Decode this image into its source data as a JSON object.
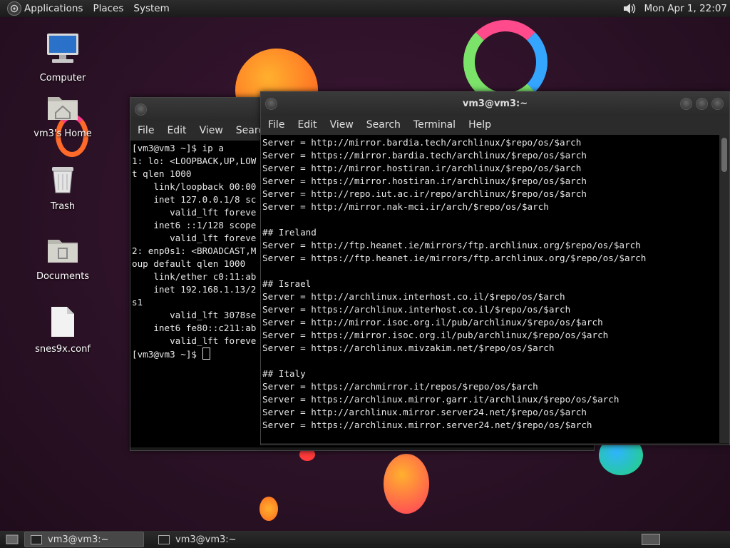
{
  "panel": {
    "menus": [
      "Applications",
      "Places",
      "System"
    ],
    "clock": "Mon Apr 1, 22:07"
  },
  "desktop_icons": [
    {
      "label": "Computer"
    },
    {
      "label": "vm3's Home"
    },
    {
      "label": "Trash"
    },
    {
      "label": "Documents"
    },
    {
      "label": "snes9x.conf"
    }
  ],
  "back_window": {
    "menus": [
      "File",
      "Edit",
      "View",
      "Search"
    ],
    "lines": [
      "[vm3@vm3 ~]$ ip a",
      "1: lo: <LOOPBACK,UP,LOW",
      "t qlen 1000",
      "    link/loopback 00:00",
      "    inet 127.0.0.1/8 sc",
      "       valid_lft foreve",
      "    inet6 ::1/128 scope",
      "       valid_lft foreve",
      "2: enp0s1: <BROADCAST,M",
      "oup default qlen 1000",
      "    link/ether c0:11:ab",
      "    inet 192.168.1.13/2",
      "s1",
      "       valid_lft 3078se",
      "    inet6 fe80::c211:ab",
      "       valid_lft foreve"
    ],
    "prompt": "[vm3@vm3 ~]$ "
  },
  "front_window": {
    "title": "vm3@vm3:~",
    "menus": [
      "File",
      "Edit",
      "View",
      "Search",
      "Terminal",
      "Help"
    ],
    "lines": [
      "Server = http://mirror.bardia.tech/archlinux/$repo/os/$arch",
      "Server = https://mirror.bardia.tech/archlinux/$repo/os/$arch",
      "Server = http://mirror.hostiran.ir/archlinux/$repo/os/$arch",
      "Server = https://mirror.hostiran.ir/archlinux/$repo/os/$arch",
      "Server = http://repo.iut.ac.ir/repo/archlinux/$repo/os/$arch",
      "Server = http://mirror.nak-mci.ir/arch/$repo/os/$arch",
      "",
      "## Ireland",
      "Server = http://ftp.heanet.ie/mirrors/ftp.archlinux.org/$repo/os/$arch",
      "Server = https://ftp.heanet.ie/mirrors/ftp.archlinux.org/$repo/os/$arch",
      "",
      "## Israel",
      "Server = http://archlinux.interhost.co.il/$repo/os/$arch",
      "Server = https://archlinux.interhost.co.il/$repo/os/$arch",
      "Server = http://mirror.isoc.org.il/pub/archlinux/$repo/os/$arch",
      "Server = https://mirror.isoc.org.il/pub/archlinux/$repo/os/$arch",
      "Server = https://archlinux.mivzakim.net/$repo/os/$arch",
      "",
      "## Italy",
      "Server = https://archmirror.it/repos/$repo/os/$arch",
      "Server = https://archlinux.mirror.garr.it/archlinux/$repo/os/$arch",
      "Server = http://archlinux.mirror.server24.net/$repo/os/$arch",
      "Server = https://archlinux.mirror.server24.net/$repo/os/$arch"
    ]
  },
  "taskbar": {
    "tasks": [
      "vm3@vm3:~",
      "vm3@vm3:~"
    ]
  }
}
